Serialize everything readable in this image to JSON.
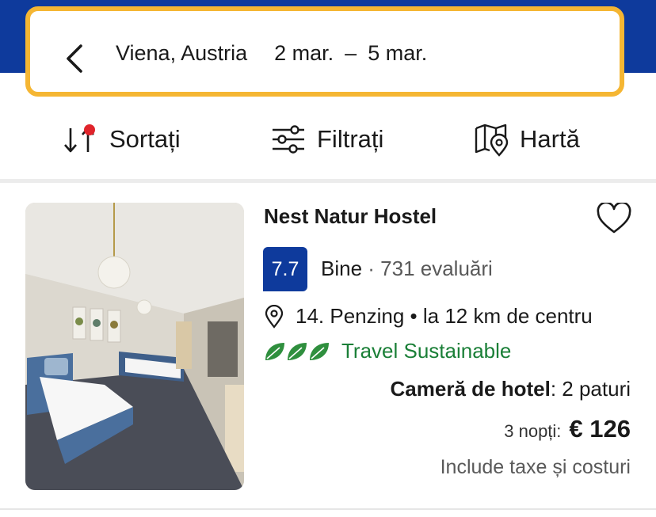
{
  "search": {
    "location": "Viena, Austria",
    "date_start": "2 mar.",
    "date_separator": "–",
    "date_end": "5 mar."
  },
  "toolbar": {
    "sort_label": "Sortați",
    "filter_label": "Filtrați",
    "map_label": "Hartă"
  },
  "listing": {
    "name": "Nest Natur Hostel",
    "score": "7.7",
    "score_word": "Bine",
    "review_count": "· 731 evaluări",
    "location": "14. Penzing • la 12 km de centru",
    "sustainability": "Travel Sustainable",
    "room_type": "Cameră de hotel",
    "room_beds": ": 2 paturi",
    "nights": "3 nopți:",
    "price": "€ 126",
    "tax_note": "Include taxe și costuri"
  },
  "colors": {
    "brand_blue": "#0e3a9c",
    "search_border": "#f5b633",
    "sustainable_green": "#1a7f37",
    "sort_dot_red": "#e0242b"
  },
  "icons": {
    "back": "chevron-left-icon",
    "sort": "sort-icon",
    "filter": "sliders-icon",
    "map": "map-pin-icon",
    "favorite": "heart-icon",
    "location": "location-pin-icon",
    "leaf": "leaf-icon"
  }
}
